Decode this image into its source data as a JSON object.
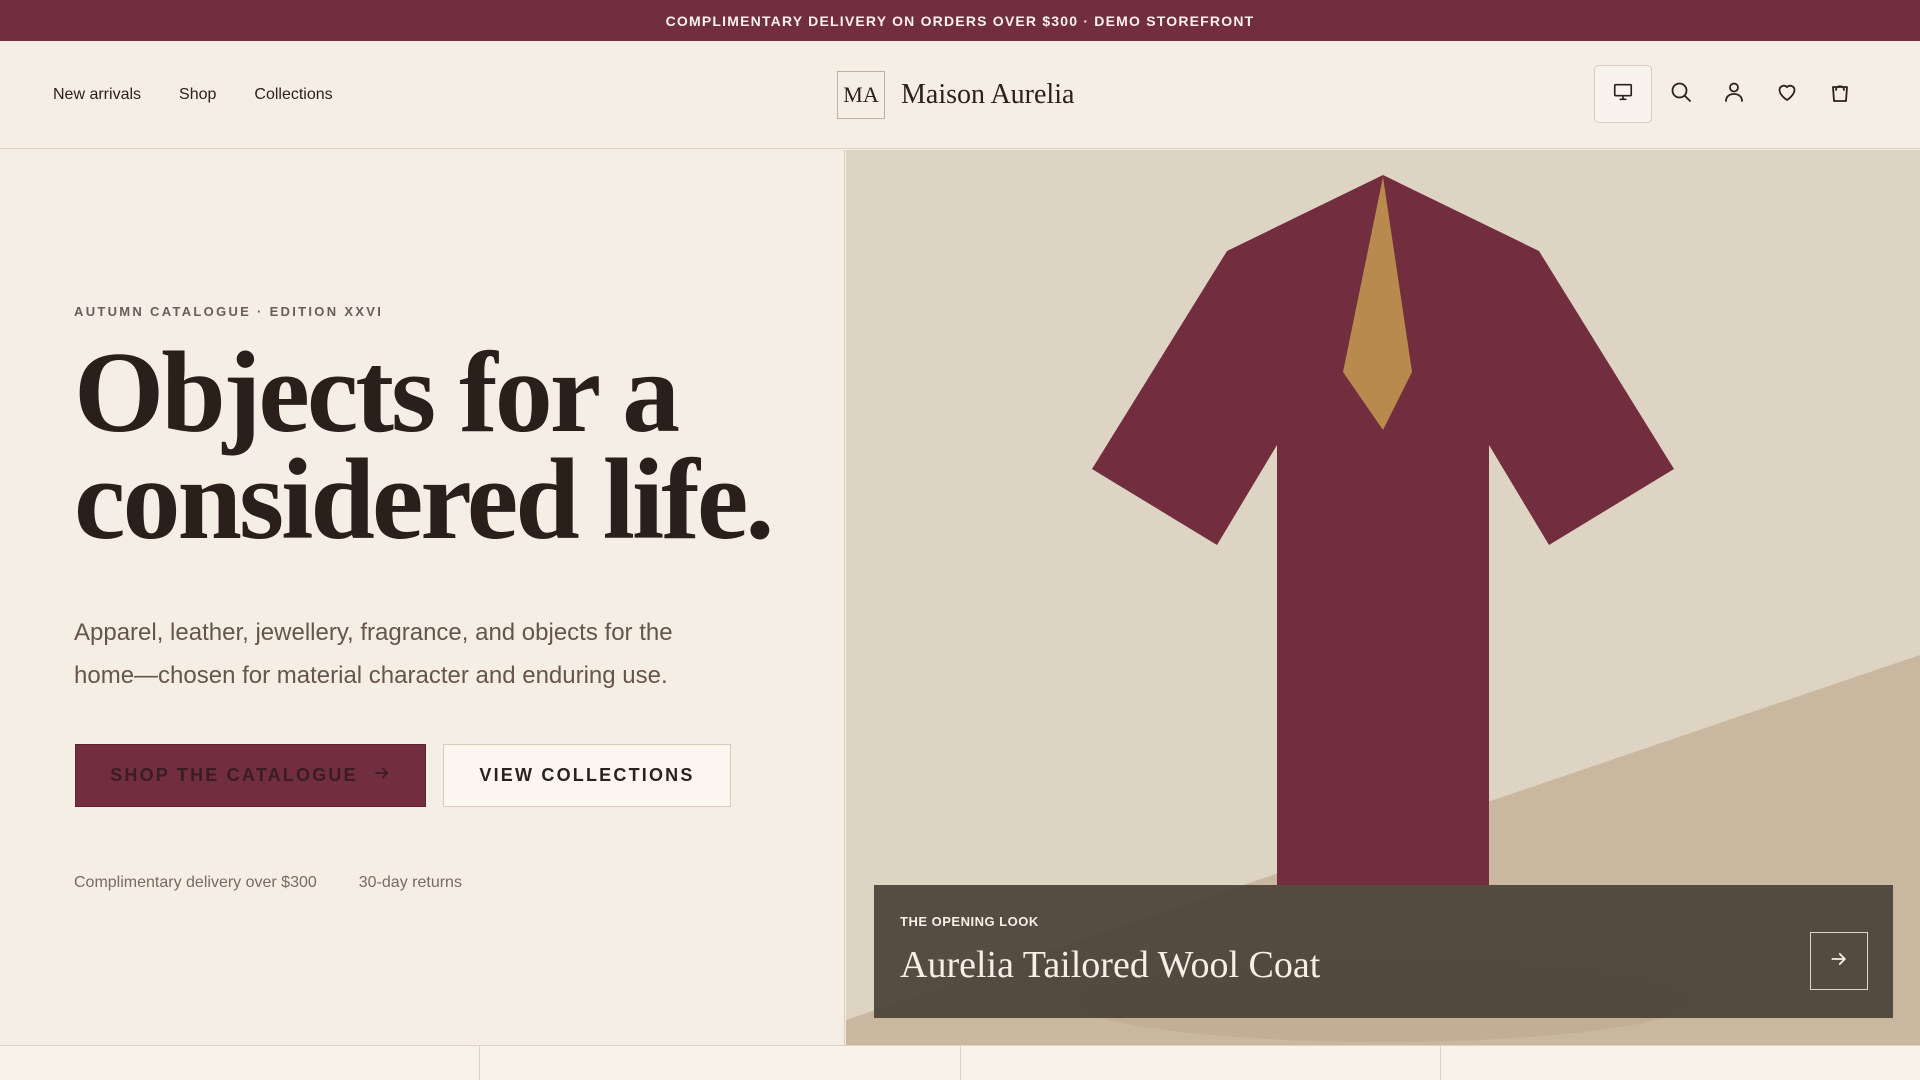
{
  "announcement": "COMPLIMENTARY DELIVERY ON ORDERS OVER $300 · DEMO STOREFRONT",
  "header": {
    "nav": [
      "New arrivals",
      "Shop",
      "Collections"
    ],
    "monogram": "MA",
    "brand": "Maison Aurelia",
    "icons": [
      "display-icon",
      "search-icon",
      "account-icon",
      "wishlist-icon",
      "bag-icon"
    ]
  },
  "hero": {
    "kicker": "AUTUMN CATALOGUE · EDITION XXVI",
    "headline_line_1": "Objects for a",
    "headline_line_2": "considered life.",
    "lead_line_1": "Apparel, leather, jewellery, fragrance, and objects for the",
    "lead_line_2": "home—chosen for material character and enduring use.",
    "primary_button": "SHOP THE CATALOGUE",
    "secondary_button": "VIEW COLLECTIONS",
    "perks": [
      "Complimentary delivery over $300",
      "30-day returns"
    ]
  },
  "feature": {
    "label": "THE OPENING LOOK",
    "title": "Aurelia Tailored Wool Coat"
  },
  "colors": {
    "brand": "#722e3f",
    "cream": "#f4eee5",
    "gold": "#b98a4d",
    "text": "#2b211d"
  }
}
